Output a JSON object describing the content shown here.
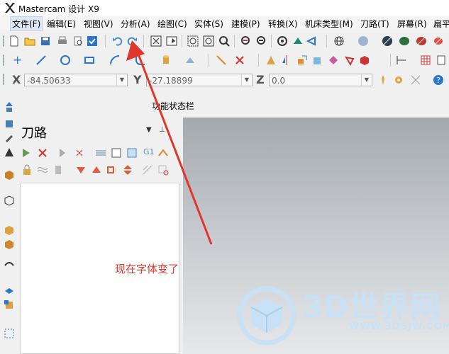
{
  "window": {
    "title": "Mastercam 设计 X9"
  },
  "menu": [
    {
      "label": "文件(F)",
      "active": true
    },
    {
      "label": "编辑(E)"
    },
    {
      "label": "视图(V)"
    },
    {
      "label": "分析(A)"
    },
    {
      "label": "绘图(C)"
    },
    {
      "label": "实体(S)"
    },
    {
      "label": "建模(P)"
    },
    {
      "label": "转换(X)"
    },
    {
      "label": "机床类型(M)"
    },
    {
      "label": "刀路(T)"
    },
    {
      "label": "屏幕(R)"
    },
    {
      "label": "扁平"
    }
  ],
  "coords": {
    "x_label": "X",
    "x_value": "-84.50633",
    "y_label": "Y",
    "y_value": "-27.18899",
    "z_label": "Z",
    "z_value": "0.0"
  },
  "ribbon": {
    "function_bar_label": "功能状态栏"
  },
  "panel": {
    "title": "刀路",
    "pin_glyph": "▼",
    "close_glyph": "⊥"
  },
  "annotation": {
    "text": "现在字体变了"
  },
  "watermark": {
    "text": "3D世界网",
    "sub": "WWW.3DSJW.COM"
  },
  "colors": {
    "annotation": "#e0362b",
    "watermark": "#c9e1f4",
    "accent": "#2a77c9"
  }
}
